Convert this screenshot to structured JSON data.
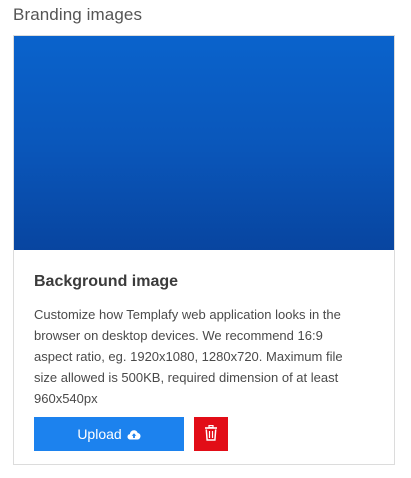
{
  "section": {
    "title": "Branding images"
  },
  "card": {
    "title": "Background image",
    "description": "Customize how Templafy web application looks in the\nbrowser on desktop devices. We recommend 16:9\naspect ratio, eg. 1920x1080, 1280x720. Maximum file\nsize allowed is 500KB, required dimension of at least\n960x540px",
    "upload_label": "Upload",
    "upload_icon": "cloud-upload-icon",
    "delete_icon": "trash-icon"
  },
  "colors": {
    "preview_gradient_top": "#0a63cc",
    "preview_gradient_bottom": "#0845a0",
    "upload_button": "#1c82ee",
    "delete_button": "#e20d17"
  }
}
